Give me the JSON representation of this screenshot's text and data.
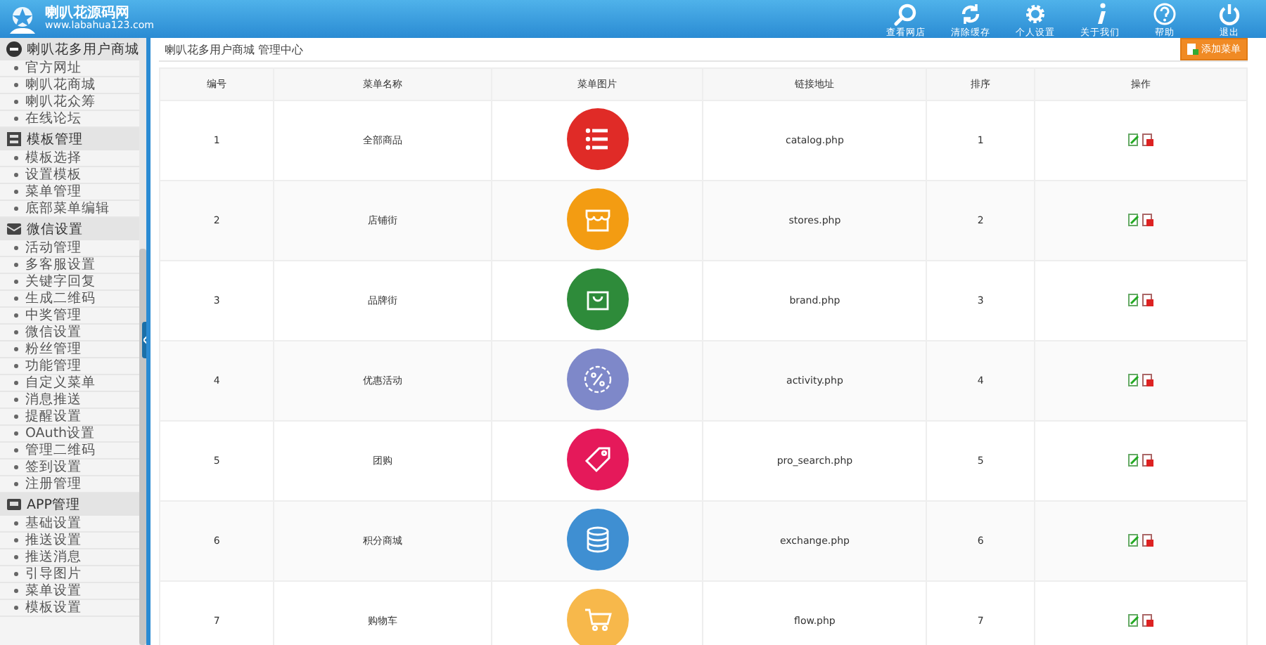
{
  "logo": {
    "title": "喇叭花源码网",
    "url": "www.labahua123.com"
  },
  "top_nav": [
    {
      "label": "查看网店"
    },
    {
      "label": "清除缓存"
    },
    {
      "label": "个人设置"
    },
    {
      "label": "关于我们"
    },
    {
      "label": "帮助"
    },
    {
      "label": "退出"
    }
  ],
  "sidebar": {
    "groups": [
      {
        "title": "喇叭花多用户商城",
        "expanded": true,
        "items": [
          "官方网址",
          "喇叭花商城",
          "喇叭花众筹",
          "在线论坛"
        ]
      },
      {
        "title": "模板管理",
        "expanded": true,
        "items": [
          "模板选择",
          "设置模板",
          "菜单管理",
          "底部菜单编辑"
        ]
      },
      {
        "title": "微信设置",
        "expanded": true,
        "items": [
          "活动管理",
          "多客服设置",
          "关键字回复",
          "生成二维码",
          "中奖管理",
          "微信设置",
          "粉丝管理",
          "功能管理",
          "自定义菜单",
          "消息推送",
          "提醒设置",
          "OAuth设置",
          "管理二维码",
          "签到设置",
          "注册管理"
        ]
      },
      {
        "title": "APP管理",
        "expanded": true,
        "items": [
          "基础设置",
          "推送设置",
          "推送消息",
          "引导图片",
          "菜单设置",
          "模板设置"
        ]
      }
    ]
  },
  "breadcrumb": "喇叭花多用户商城 管理中心",
  "add_button": "添加菜单",
  "table": {
    "columns": [
      "编号",
      "菜单名称",
      "菜单图片",
      "链接地址",
      "排序",
      "操作"
    ],
    "rows": [
      {
        "id": "1",
        "name": "全部商品",
        "color": "#e02b27",
        "link": "catalog.php",
        "order": "1"
      },
      {
        "id": "2",
        "name": "店铺街",
        "color": "#f39c12",
        "link": "stores.php",
        "order": "2"
      },
      {
        "id": "3",
        "name": "品牌街",
        "color": "#2e8b3a",
        "link": "brand.php",
        "order": "3"
      },
      {
        "id": "4",
        "name": "优惠活动",
        "color": "#7e88c9",
        "link": "activity.php",
        "order": "4"
      },
      {
        "id": "5",
        "name": "团购",
        "color": "#e5195a",
        "link": "pro_search.php",
        "order": "5"
      },
      {
        "id": "6",
        "name": "积分商城",
        "color": "#3f8fd2",
        "link": "exchange.php",
        "order": "6"
      },
      {
        "id": "7",
        "name": "购物车",
        "color": "#f7b84b",
        "link": "flow.php",
        "order": "7"
      }
    ]
  }
}
